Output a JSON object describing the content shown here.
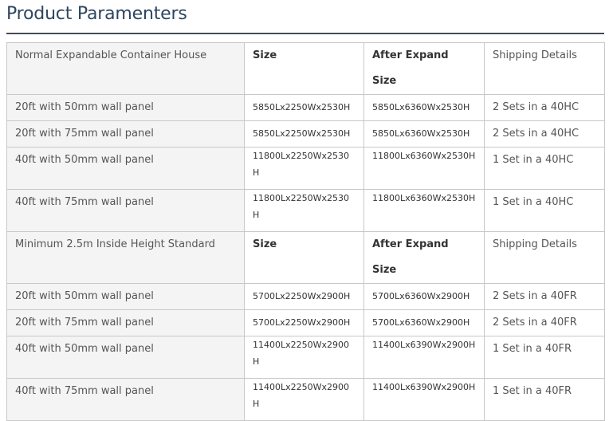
{
  "title": "Product Paramenters",
  "sections": [
    {
      "header": {
        "name": "Normal Expandable Container House",
        "size": "Size",
        "after_expand": "After Expand Size",
        "shipping": "Shipping Details"
      },
      "rows": [
        {
          "name": "20ft with 50mm wall panel",
          "size": "5850Lx2250Wx2530H",
          "after_expand": "5850Lx6360Wx2530H",
          "shipping": "2 Sets in a 40HC"
        },
        {
          "name": "20ft with 75mm wall panel",
          "size": "5850Lx2250Wx2530H",
          "after_expand": "5850Lx6360Wx2530H",
          "shipping": "2 Sets in a 40HC"
        },
        {
          "name": "40ft with 50mm wall panel",
          "size": "11800Lx2250Wx2530H",
          "after_expand": "11800Lx6360Wx2530H",
          "shipping": "1 Set in a 40HC"
        },
        {
          "name": "40ft with 75mm wall panel",
          "size": "11800Lx2250Wx2530H",
          "after_expand": "11800Lx6360Wx2530H",
          "shipping": "1 Set in a 40HC"
        }
      ]
    },
    {
      "header": {
        "name": "Minimum 2.5m Inside Height Standard",
        "size": "Size",
        "after_expand": "After Expand Size",
        "shipping": "Shipping Details"
      },
      "rows": [
        {
          "name": "20ft with 50mm wall panel",
          "size": "5700Lx2250Wx2900H",
          "after_expand": "5700Lx6360Wx2900H",
          "shipping": "2 Sets in a 40FR"
        },
        {
          "name": "20ft with 75mm wall panel",
          "size": "5700Lx2250Wx2900H",
          "after_expand": "5700Lx6360Wx2900H",
          "shipping": "2 Sets in a 40FR"
        },
        {
          "name": "40ft with 50mm wall panel",
          "size": "11400Lx2250Wx2900H",
          "after_expand": "11400Lx6390Wx2900H",
          "shipping": "1 Set in a 40FR"
        },
        {
          "name": "40ft with 75mm wall panel",
          "size": "11400Lx2250Wx2900H",
          "after_expand": "11400Lx6390Wx2900H",
          "shipping": "1 Set in a 40FR"
        }
      ]
    }
  ],
  "colors": {
    "title": "#2e4560",
    "rule": "#444c55",
    "border": "#c8c8c8",
    "shaded_cell": "#f4f4f4"
  }
}
